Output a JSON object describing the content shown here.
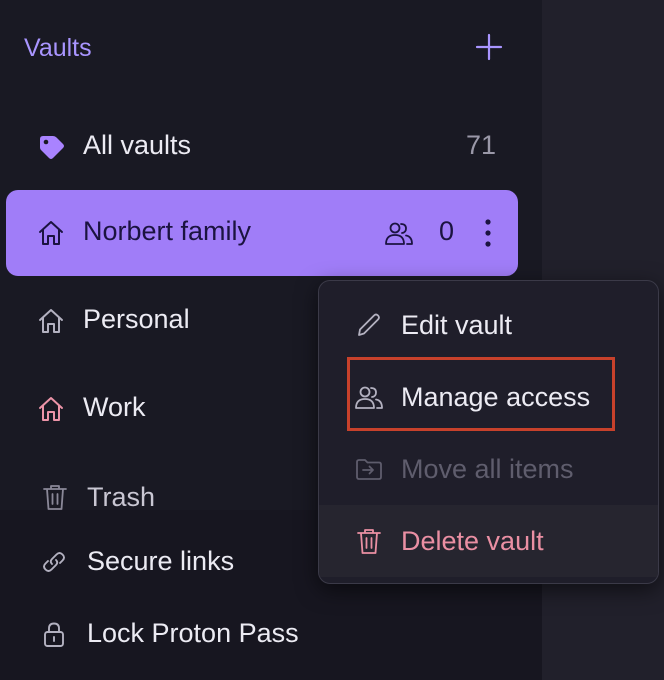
{
  "vaults": {
    "title": "Vaults",
    "add_icon": "plus-icon",
    "items": [
      {
        "label": "All vaults",
        "count": "71",
        "icon": "vault-diamond-icon"
      },
      {
        "label": "Norbert family",
        "count": "0",
        "icon": "home-icon",
        "active": true
      },
      {
        "label": "Personal",
        "icon": "home-icon"
      },
      {
        "label": "Work",
        "icon": "home-icon",
        "icon_color": "#ec94a8"
      }
    ]
  },
  "trash": {
    "label": "Trash",
    "icon": "trash-icon"
  },
  "bottom": {
    "secure_links": "Secure links",
    "lock": "Lock Proton Pass"
  },
  "context_menu": {
    "items": [
      {
        "label": "Edit vault",
        "icon": "pencil-icon"
      },
      {
        "label": "Manage access",
        "icon": "users-icon"
      },
      {
        "label": "Move all items",
        "icon": "move-icon",
        "disabled": true
      },
      {
        "label": "Delete vault",
        "icon": "trash-icon",
        "danger": true
      }
    ]
  },
  "colors": {
    "accent": "#a995ff",
    "active_row": "#a07df8",
    "danger": "#ea8fa3",
    "highlight": "#c7412b"
  }
}
